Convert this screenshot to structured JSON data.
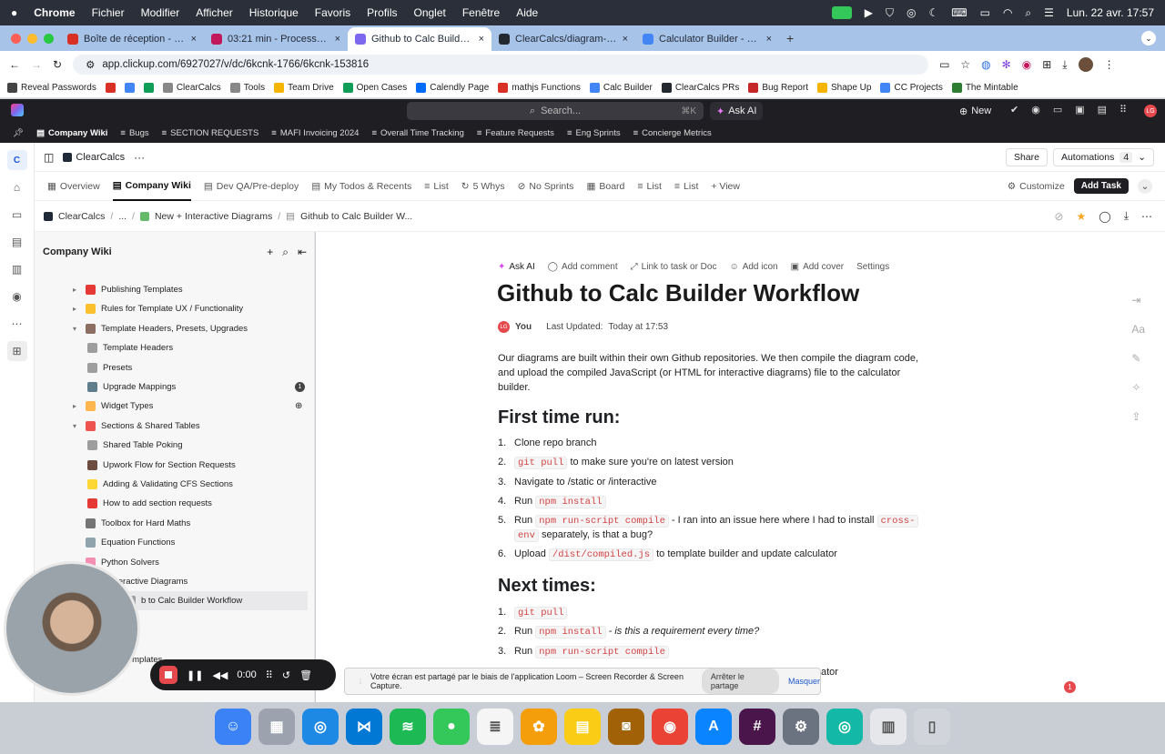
{
  "macbar": {
    "apple": "",
    "app": "Chrome",
    "menus": [
      "Fichier",
      "Modifier",
      "Afficher",
      "Historique",
      "Favoris",
      "Profils",
      "Onglet",
      "Fenêtre",
      "Aide"
    ],
    "clock": "Lun. 22 avr. 17:57"
  },
  "browser": {
    "tabs": [
      {
        "title": "Boîte de réception - laurent.",
        "color": "#d93025"
      },
      {
        "title": "03:21 min - Process for diag",
        "color": "#c2185b"
      },
      {
        "title": "Github to Calc Builder W",
        "color": "#7b68ee",
        "active": true
      },
      {
        "title": "ClearCalcs/diagram-mafi-sc",
        "color": "#24292f"
      },
      {
        "title": "Calculator Builder - ClearCalc",
        "color": "#4285f4"
      }
    ],
    "new_tab": "+",
    "url": "app.clickup.com/6927027/v/dc/6kcnk-1766/6kcnk-153816",
    "bookmarks": [
      {
        "label": "Reveal Passwords",
        "color": "#444"
      },
      {
        "label": "",
        "color": "#d93025"
      },
      {
        "label": "",
        "color": "#4285f4"
      },
      {
        "label": "",
        "color": "#0f9d58"
      },
      {
        "label": "ClearCalcs",
        "color": "#888"
      },
      {
        "label": "Tools",
        "color": "#888"
      },
      {
        "label": "Team Drive",
        "color": "#f4b400"
      },
      {
        "label": "Open Cases",
        "color": "#0f9d58"
      },
      {
        "label": "Calendly Page",
        "color": "#006bff"
      },
      {
        "label": "mathjs Functions",
        "color": "#d93025"
      },
      {
        "label": "Calc Builder",
        "color": "#4285f4"
      },
      {
        "label": "ClearCalcs PRs",
        "color": "#24292f"
      },
      {
        "label": "Bug Report",
        "color": "#c62828"
      },
      {
        "label": "Shape Up",
        "color": "#f4b400"
      },
      {
        "label": "CC Projects",
        "color": "#4285f4"
      },
      {
        "label": "The Mintable",
        "color": "#2e7d32"
      }
    ]
  },
  "clickup": {
    "search": "Search...",
    "search_kbd": "⌘K",
    "ask_ai": "Ask AI",
    "new": "New",
    "avatar": "LG",
    "favorites": [
      "Company Wiki",
      "Bugs",
      "SECTION REQUESTS",
      "MAFI Invoicing 2024",
      "Overall Time Tracking",
      "Feature Requests",
      "Eng Sprints",
      "Concierge Metrics"
    ],
    "workspace": "ClearCalcs",
    "workspace_more": "···",
    "share": "Share",
    "automations": "Automations",
    "automations_count": "4",
    "views": [
      "Overview",
      "Company Wiki",
      "Dev QA/Pre-deploy",
      "My Todos & Recents",
      "List",
      "5 Whys",
      "No Sprints",
      "Board",
      "List",
      "List",
      "+ View"
    ],
    "customize": "Customize",
    "add_task": "Add Task",
    "breadcrumb": [
      "ClearCalcs",
      "...",
      "New + Interactive Diagrams",
      "Github to Calc Builder W..."
    ]
  },
  "sidebar": {
    "title": "Company Wiki",
    "items": [
      {
        "label": "Publishing Templates",
        "indent": 1,
        "caret": "▸",
        "emo": "#e53935"
      },
      {
        "label": "Rules for Template UX / Functionality",
        "indent": 1,
        "caret": "▸",
        "emo": "#fbc02d"
      },
      {
        "label": "Template Headers, Presets, Upgrades",
        "indent": 1,
        "caret": "▾",
        "emo": "#8d6e63"
      },
      {
        "label": "Template Headers",
        "indent": 2,
        "caret": "",
        "emo": "#9e9e9e"
      },
      {
        "label": "Presets",
        "indent": 2,
        "caret": "",
        "emo": "#9e9e9e"
      },
      {
        "label": "Upgrade Mappings",
        "indent": 2,
        "caret": "",
        "emo": "#607d8b",
        "badge": "1"
      },
      {
        "label": "Widget Types",
        "indent": 1,
        "caret": "▸",
        "emo": "#ffb74d",
        "globe": "⊕"
      },
      {
        "label": "Sections & Shared Tables",
        "indent": 1,
        "caret": "▾",
        "emo": "#ef5350"
      },
      {
        "label": "Shared Table Poking",
        "indent": 2,
        "caret": "",
        "emo": "#9e9e9e"
      },
      {
        "label": "Upwork Flow for Section Requests",
        "indent": 2,
        "caret": "",
        "emo": "#6d4c41"
      },
      {
        "label": "Adding & Validating CFS Sections",
        "indent": 2,
        "caret": "",
        "emo": "#fdd835"
      },
      {
        "label": "How to add section requests",
        "indent": 2,
        "caret": "",
        "emo": "#e53935"
      },
      {
        "label": "Toolbox for Hard Maths",
        "indent": 1,
        "caret": "",
        "emo": "#757575"
      },
      {
        "label": "Equation Functions",
        "indent": 1,
        "caret": "",
        "emo": "#90a4ae"
      },
      {
        "label": "Python Solvers",
        "indent": 1,
        "caret": "▸",
        "emo": "#f48fb1"
      },
      {
        "label": "+ Interactive Diagrams",
        "indent": 1,
        "caret": "▾",
        "emo": "#66bb6a"
      },
      {
        "label": "b to Calc Builder Workflow",
        "indent": 2,
        "caret": "",
        "emo": "#9e9e9e",
        "selected": true
      },
      {
        "label": "rams",
        "indent": 2,
        "caret": "",
        "emo": "#9e9e9e"
      },
      {
        "label": "ects",
        "indent": 1,
        "caret": "",
        "emo": "#9e9e9e"
      },
      {
        "label": "ecific Templates",
        "indent": 1,
        "caret": "",
        "emo": "#9e9e9e"
      }
    ]
  },
  "doc": {
    "toolbar": [
      "Ask AI",
      "Add comment",
      "Link to task or Doc",
      "Add icon",
      "Add cover",
      "Settings"
    ],
    "title": "Github to Calc Builder Workflow",
    "author_avatar": "LG",
    "author": "You",
    "updated_label": "Last Updated:",
    "updated": "Today at 17:53",
    "intro": [
      "Our diagrams are built within their own Github repositories. We then compile the diagram code,",
      "and upload the compiled JavaScript (or HTML for interactive diagrams) file to the calculator",
      "builder."
    ],
    "h_first": "First time run:",
    "first": [
      {
        "n": "1.",
        "pre": "Clone repo branch",
        "code": "",
        "post": ""
      },
      {
        "n": "2.",
        "pre": "",
        "code": "git pull",
        "post": " to make sure you're on latest version"
      },
      {
        "n": "3.",
        "pre": "Navigate to /static or /interactive",
        "code": "",
        "post": ""
      },
      {
        "n": "4.",
        "pre": "Run ",
        "code": "npm install",
        "post": ""
      },
      {
        "n": "5.",
        "pre": "Run ",
        "code": "npm run-script compile",
        "post": " - I ran into an issue here where I had to install ",
        "code2": "cross-"
      },
      {
        "n": "",
        "pre": "",
        "code": "env",
        "post": " separately, is that a bug?"
      },
      {
        "n": "6.",
        "pre": "Upload ",
        "code": "/dist/compiled.js",
        "post": " to template builder and update calculator"
      }
    ],
    "h_next": "Next times:",
    "next": [
      {
        "n": "1.",
        "pre": "",
        "code": "git pull",
        "post": ""
      },
      {
        "n": "2.",
        "pre": "Run ",
        "code": "npm install",
        "post": " - is this a requirement every time?"
      },
      {
        "n": "3.",
        "pre": "Run ",
        "code": "npm run-script compile",
        "post": ""
      }
    ],
    "last_fragment": "ator"
  },
  "loom": {
    "time": "0:00",
    "share_msg": "Votre écran est partagé par le biais de l'application Loom – Screen Recorder & Screen Capture.",
    "stop": "Arrêter le partage",
    "hide": "Masquer"
  },
  "notification": "1",
  "dock": [
    {
      "name": "finder",
      "color": "#3b82f6",
      "glyph": "☺"
    },
    {
      "name": "launchpad",
      "color": "#9ca3af",
      "glyph": "▦"
    },
    {
      "name": "safari",
      "color": "#1e88e5",
      "glyph": "◎"
    },
    {
      "name": "vscode",
      "color": "#0078d4",
      "glyph": "⋈"
    },
    {
      "name": "spotify",
      "color": "#1db954",
      "glyph": "≋"
    },
    {
      "name": "messages",
      "color": "#34c759",
      "glyph": "●"
    },
    {
      "name": "reminders",
      "color": "#f5f5f5",
      "glyph": "≣"
    },
    {
      "name": "photos",
      "color": "#f59e0b",
      "glyph": "✿"
    },
    {
      "name": "notes",
      "color": "#facc15",
      "glyph": "▤"
    },
    {
      "name": "contacts",
      "color": "#a16207",
      "glyph": "◙"
    },
    {
      "name": "chrome",
      "color": "#ea4335",
      "glyph": "◉"
    },
    {
      "name": "app-store",
      "color": "#0a84ff",
      "glyph": "A"
    },
    {
      "name": "slack",
      "color": "#4a154b",
      "glyph": "#"
    },
    {
      "name": "system-settings",
      "color": "#6b7280",
      "glyph": "⚙"
    },
    {
      "name": "loom",
      "color": "#14b8a6",
      "glyph": "◎"
    },
    {
      "name": "document",
      "color": "#e5e7eb",
      "glyph": "▥"
    },
    {
      "name": "trash",
      "color": "#d1d5db",
      "glyph": "▯"
    }
  ]
}
